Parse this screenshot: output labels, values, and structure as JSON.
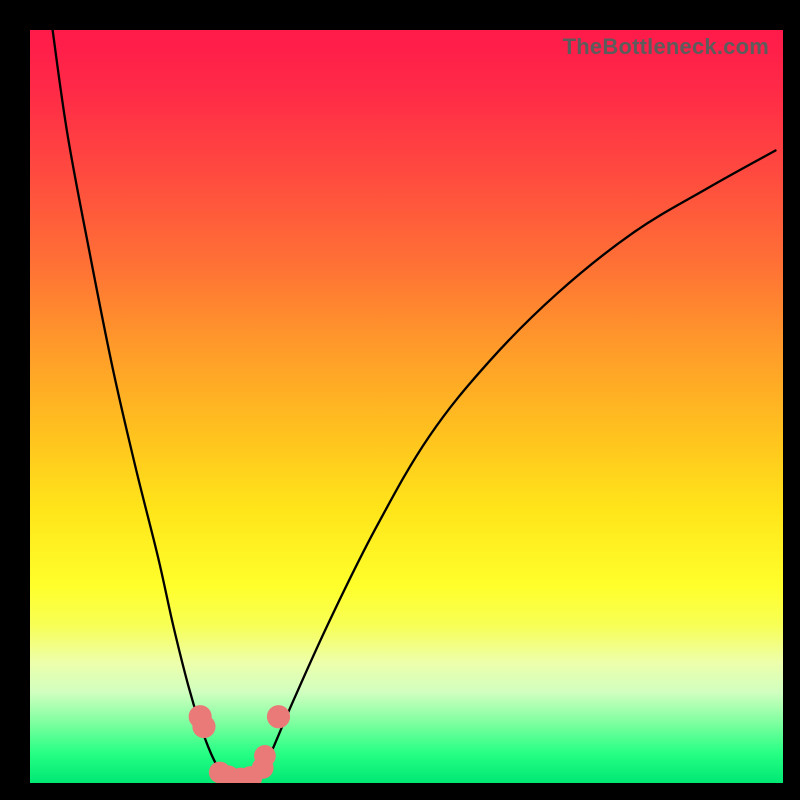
{
  "watermark": "TheBottleneck.com",
  "colors": {
    "frame": "#000000",
    "curve": "#000000",
    "marker_fill": "#e97a78",
    "gradient_top": "#ff1a4a",
    "gradient_bottom": "#00e874"
  },
  "chart_data": {
    "type": "line",
    "title": "",
    "xlabel": "",
    "ylabel": "",
    "xlim": [
      0,
      100
    ],
    "ylim": [
      0,
      100
    ],
    "note": "Axes are unlabeled; values are normalized 0–100 estimated from pixel positions. y = 0 at bottom (green), y = 100 at top (red). Curve resembles a bottleneck profile with minimum near x ≈ 26.",
    "series": [
      {
        "name": "left-branch",
        "x": [
          3,
          5,
          8,
          11,
          14,
          17,
          19,
          21,
          22.5,
          24,
          25.5
        ],
        "y": [
          100,
          86,
          70,
          55,
          42,
          30,
          21,
          13,
          8,
          4,
          1
        ]
      },
      {
        "name": "floor",
        "x": [
          25.5,
          27,
          29,
          30.5
        ],
        "y": [
          1,
          0.5,
          0.5,
          1
        ]
      },
      {
        "name": "right-branch",
        "x": [
          30.5,
          32,
          35,
          40,
          46,
          53,
          61,
          70,
          80,
          90,
          99
        ],
        "y": [
          1,
          4,
          11,
          22,
          34,
          46,
          56,
          65,
          73,
          79,
          84
        ]
      }
    ],
    "markers": {
      "name": "highlighted-points",
      "points": [
        {
          "x": 22.6,
          "y": 8.8,
          "r": 1.2
        },
        {
          "x": 23.1,
          "y": 7.5,
          "r": 1.2
        },
        {
          "x": 25.2,
          "y": 1.4,
          "r": 1.1
        },
        {
          "x": 26.3,
          "y": 0.8,
          "r": 1.2
        },
        {
          "x": 28.0,
          "y": 0.6,
          "r": 1.1
        },
        {
          "x": 29.3,
          "y": 0.7,
          "r": 1.2
        },
        {
          "x": 30.9,
          "y": 2.0,
          "r": 1.1
        },
        {
          "x": 31.2,
          "y": 3.6,
          "r": 1.1
        },
        {
          "x": 33.0,
          "y": 8.8,
          "r": 1.2
        }
      ]
    }
  }
}
